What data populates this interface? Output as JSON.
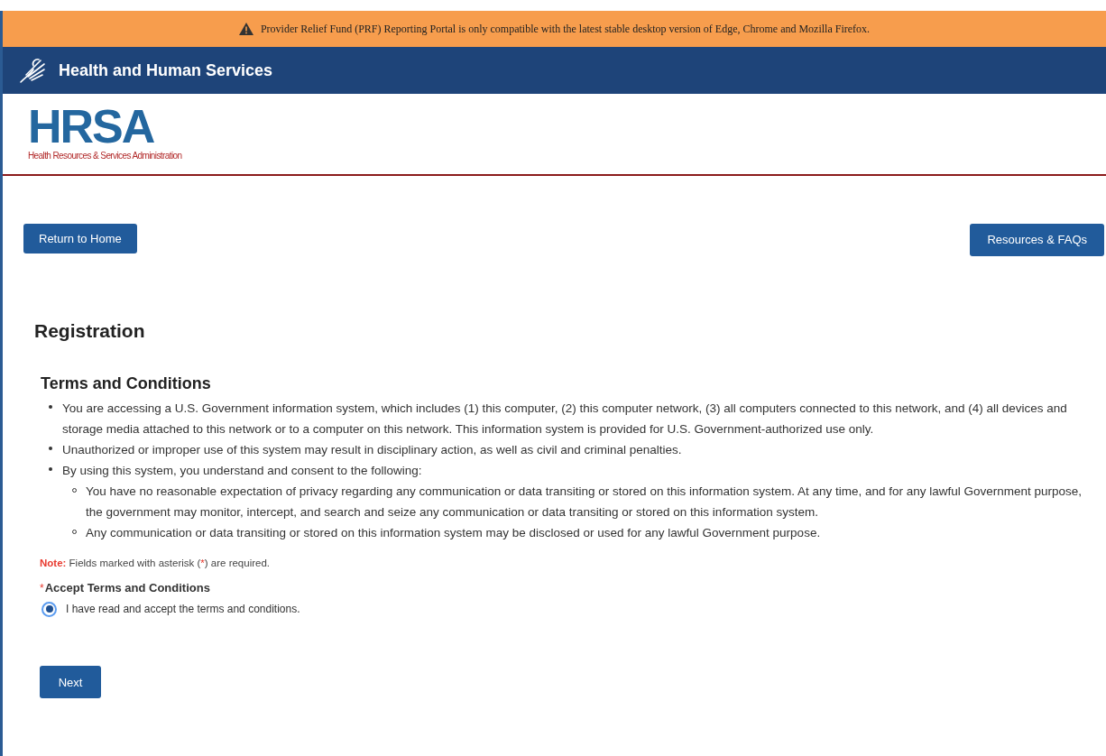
{
  "banner": {
    "text": "Provider Relief Fund (PRF) Reporting Portal is only compatible with the latest stable desktop version of Edge, Chrome and Mozilla Firefox."
  },
  "header": {
    "title": "Health and Human Services"
  },
  "logo": {
    "mark": "HRSA",
    "subtitle": "Health Resources & Services Administration"
  },
  "nav_buttons": [
    "Return to Home",
    "Resources & FAQs"
  ],
  "page_title": "Registration",
  "section_title": "Terms and Conditions",
  "terms": [
    {
      "text": "You are accessing a U.S. Government information system, which includes (1) this computer, (2) this computer network, (3) all computers connected to this network, and (4) all devices and storage media attached to this network or to a computer on this network. This information system is provided for U.S. Government-authorized use only."
    },
    {
      "text": "Unauthorized or improper use of this system may result in disciplinary action, as well as civil and criminal penalties."
    },
    {
      "text": "By using this system, you understand and consent to the following:",
      "children": [
        {
          "text": "You have no reasonable expectation of privacy regarding any communication or data transiting or stored on this information system. At any time, and for any lawful Government purpose, the government may monitor, intercept, and search and seize any communication or data transiting or stored on this information system."
        },
        {
          "text": "Any communication or data transiting or stored on this information system may be disclosed or used for any lawful Government purpose."
        }
      ]
    }
  ],
  "note": {
    "label": "Note:",
    "before": "Fields marked with asterisk (",
    "mark": "*",
    "after": ") are required."
  },
  "field": {
    "required_mark": "*",
    "label": "Accept Terms and Conditions",
    "option": {
      "label": "I have read and accept the terms and conditions.",
      "selected": true
    }
  },
  "submit": "Next"
}
